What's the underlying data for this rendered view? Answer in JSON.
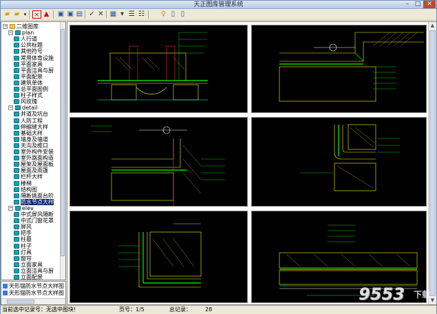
{
  "app": {
    "title": "天正图库管理系统"
  },
  "window_buttons": {
    "minimize": "–",
    "maximize": "□",
    "close": "✕"
  },
  "toolbar": {
    "icons": [
      "folder-open-icon",
      "folder-new-icon",
      "dropdown-icon",
      "select-icon",
      "delete-icon",
      "import-icon",
      "export-icon",
      "print-icon",
      "check-icon",
      "cross-icon",
      "grid-icon",
      "view-icon",
      "list-icon",
      "help-icon",
      "info-icon",
      "settings-icon"
    ]
  },
  "tree": {
    "root": "二维图库",
    "groups": [
      {
        "name": "plan",
        "items": [
          "人行道",
          "公共标题",
          "其他符号",
          "常用体育设施",
          "平面家具",
          "平面洁具与厨",
          "平面配景",
          "建筑单体",
          "总平面图例",
          "柱子样式",
          "风玫瑰"
        ]
      },
      {
        "name": "detail",
        "items": [
          "井道及坑台",
          "人防工程",
          "伸缩缝大样",
          "基础大样",
          "墙身及墙道",
          "天沟及檐口",
          "室外构件安装",
          "室外路面构造",
          "屋架及屋面板",
          "屋面及雨篷",
          "栏杆大样",
          "楼梯",
          "结构图",
          "隔断挑面台阶",
          "防水节点大样"
        ]
      },
      {
        "name": "elev",
        "items": [
          "中式屏风隔断",
          "中式门窗花罩",
          "屏风",
          "把手",
          "柱墓",
          "柱子",
          "灯具",
          "窗帘",
          "立面家具",
          "立面洁具与厨",
          "立面配景"
        ]
      }
    ],
    "selected": "防水节点大样"
  },
  "bottom_panel": {
    "items": [
      "天形锚防水节点大样图",
      "天形锚防水节点大样图"
    ]
  },
  "status": {
    "current_record": "当前选中记录号：无选中图块!",
    "page": "页号：1/5",
    "total": "总记录：",
    "total_value": "28"
  },
  "watermark": {
    "brand": "9553",
    "sub": "下载"
  },
  "colors": {
    "cad_background": "#000000",
    "cad_line": "#ffff00",
    "cad_green": "#00ff00",
    "cad_cyan": "#00ffff",
    "cad_white": "#ffffff",
    "selection": "#0a246a"
  }
}
